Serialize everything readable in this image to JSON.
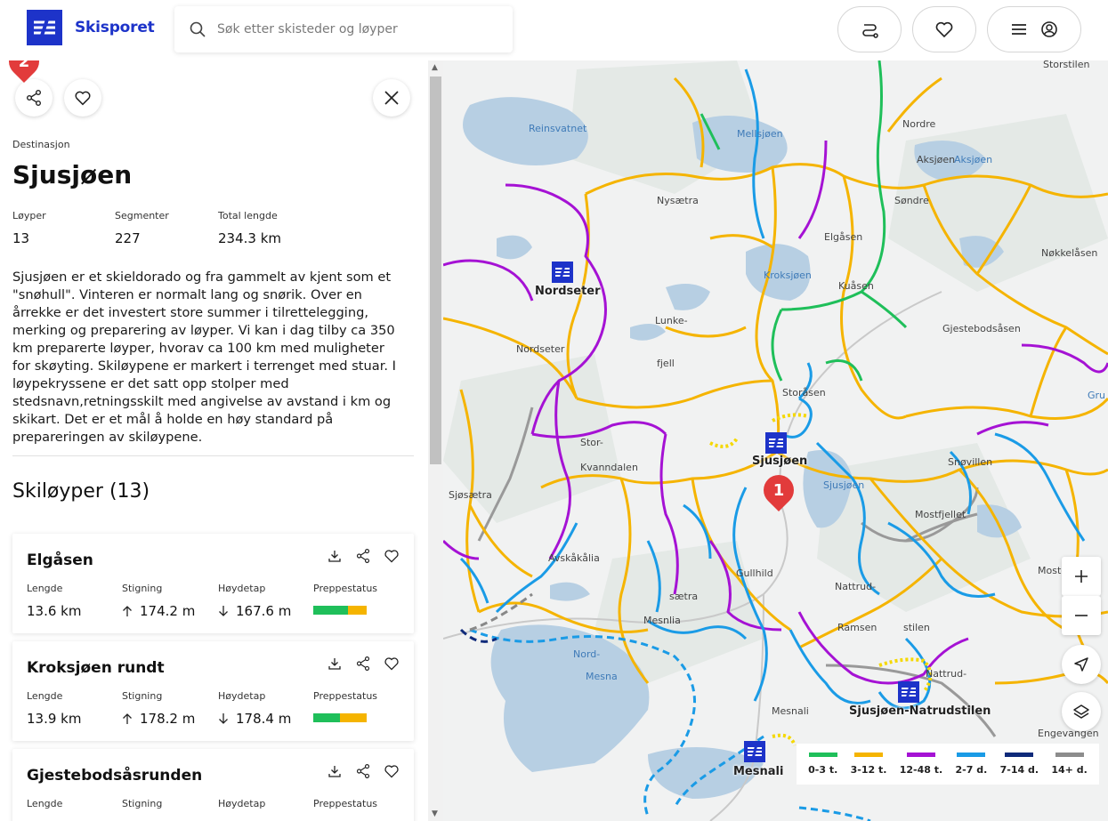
{
  "header": {
    "brand": "Skisporet",
    "search_placeholder": "Søk etter skisteder og løyper",
    "buttons": [
      "route-icon",
      "heart-icon",
      "menu-icon",
      "account-icon"
    ]
  },
  "sidebar": {
    "share_badge": "2",
    "type_label": "Destinasjon",
    "title": "Sjusjøen",
    "stats": [
      {
        "label": "Løyper",
        "value": "13"
      },
      {
        "label": "Segmenter",
        "value": "227"
      },
      {
        "label": "Total lengde",
        "value": "234.3 km"
      }
    ],
    "description": "Sjusjøen er et skieldorado og fra gammelt av kjent som et \"snøhull\". Vinteren er normalt lang og snørik. Over en årrekke er det investert store summer i tilrettelegging, merking og preparering av løyper. Vi kan i dag tilby ca 350 km preparerte løyper, hvorav ca 100 km med muligheter for skøyting. Skiløypene er markert i terrenget med stuar. I løypekryssene er det satt opp stolper med stedsnavn,retningsskilt med angivelse av avstand i km og skikart. Det er et mål å holde en høy standard på prepareringen av skiløypene.",
    "section_title": "Skiløyper (13)",
    "column_labels": {
      "length": "Lengde",
      "ascent": "Stigning",
      "descent": "Høydetap",
      "prep": "Preppestatus"
    },
    "trails": [
      {
        "name": "Elgåsen",
        "length": "13.6 km",
        "ascent": "174.2 m",
        "descent": "167.6 m",
        "prep_green": 0.65,
        "prep_yellow": 0.35
      },
      {
        "name": "Kroksjøen rundt",
        "length": "13.9 km",
        "ascent": "178.2 m",
        "descent": "178.4 m",
        "prep_green": 0.5,
        "prep_yellow": 0.5
      },
      {
        "name": "Gjestebodsåsrunden",
        "length": "",
        "ascent": "",
        "descent": "",
        "prep_green": 0,
        "prep_yellow": 0
      }
    ]
  },
  "map": {
    "marker_badge": "1",
    "places": [
      {
        "name": "Storstilen",
        "kind": "land"
      },
      {
        "name": "Reinsvatnet",
        "kind": "water"
      },
      {
        "name": "Mellsjøen",
        "kind": "water"
      },
      {
        "name": "Nordre",
        "kind": "land"
      },
      {
        "name": "Aksjøen",
        "kind": "land"
      },
      {
        "name": "Aksjøen",
        "kind": "water"
      },
      {
        "name": "Nysætra",
        "kind": "land"
      },
      {
        "name": "Søndre",
        "kind": "land"
      },
      {
        "name": "Elgåsen",
        "kind": "land"
      },
      {
        "name": "Nøkkelåsen",
        "kind": "land"
      },
      {
        "name": "Kroksjøen",
        "kind": "water"
      },
      {
        "name": "Kuåsen",
        "kind": "land"
      },
      {
        "name": "Nordseter",
        "kind": "big"
      },
      {
        "name": "Lunke-",
        "kind": "land"
      },
      {
        "name": "Gjestebodsåsen",
        "kind": "land"
      },
      {
        "name": "Nordseter",
        "kind": "land"
      },
      {
        "name": "fjell",
        "kind": "land"
      },
      {
        "name": "Storåsen",
        "kind": "land"
      },
      {
        "name": "Gru",
        "kind": "water"
      },
      {
        "name": "Stor-",
        "kind": "land"
      },
      {
        "name": "Sjusjøen",
        "kind": "big"
      },
      {
        "name": "Snøvillen",
        "kind": "land"
      },
      {
        "name": "Kvanndalen",
        "kind": "land"
      },
      {
        "name": "Sjusjøen",
        "kind": "water"
      },
      {
        "name": "Sjøsætra",
        "kind": "land"
      },
      {
        "name": "Mostfjellet",
        "kind": "land"
      },
      {
        "name": "Avskåkålia",
        "kind": "land"
      },
      {
        "name": "Gullhild",
        "kind": "land"
      },
      {
        "name": "Moste",
        "kind": "land"
      },
      {
        "name": "sætra",
        "kind": "land"
      },
      {
        "name": "Nattrud-",
        "kind": "land"
      },
      {
        "name": "Mesnlia",
        "kind": "land"
      },
      {
        "name": "Ramsen",
        "kind": "land"
      },
      {
        "name": "stilen",
        "kind": "land"
      },
      {
        "name": "Nord-",
        "kind": "water"
      },
      {
        "name": "Mesna",
        "kind": "water"
      },
      {
        "name": "Nattrud-",
        "kind": "land"
      },
      {
        "name": "Sjusjøen-Natrudstilen",
        "kind": "big"
      },
      {
        "name": "Mesnali",
        "kind": "land"
      },
      {
        "name": "Engevangen",
        "kind": "land"
      },
      {
        "name": "Mesnali",
        "kind": "big"
      }
    ],
    "legend": [
      {
        "label": "0-3 t.",
        "color": "#1fbf5a"
      },
      {
        "label": "3-12 t.",
        "color": "#f5b400"
      },
      {
        "label": "12-48 t.",
        "color": "#a512d4"
      },
      {
        "label": "2-7 d.",
        "color": "#1a9be6"
      },
      {
        "label": "7-14 d.",
        "color": "#0f2a7a"
      },
      {
        "label": "14+ d.",
        "color": "#8c8c8c"
      }
    ],
    "controls": [
      "zoom-in-icon",
      "zoom-out-icon",
      "locate-icon",
      "layers-icon"
    ]
  },
  "colors": {
    "brand": "#1d33c9",
    "pin": "#e23b3b"
  }
}
